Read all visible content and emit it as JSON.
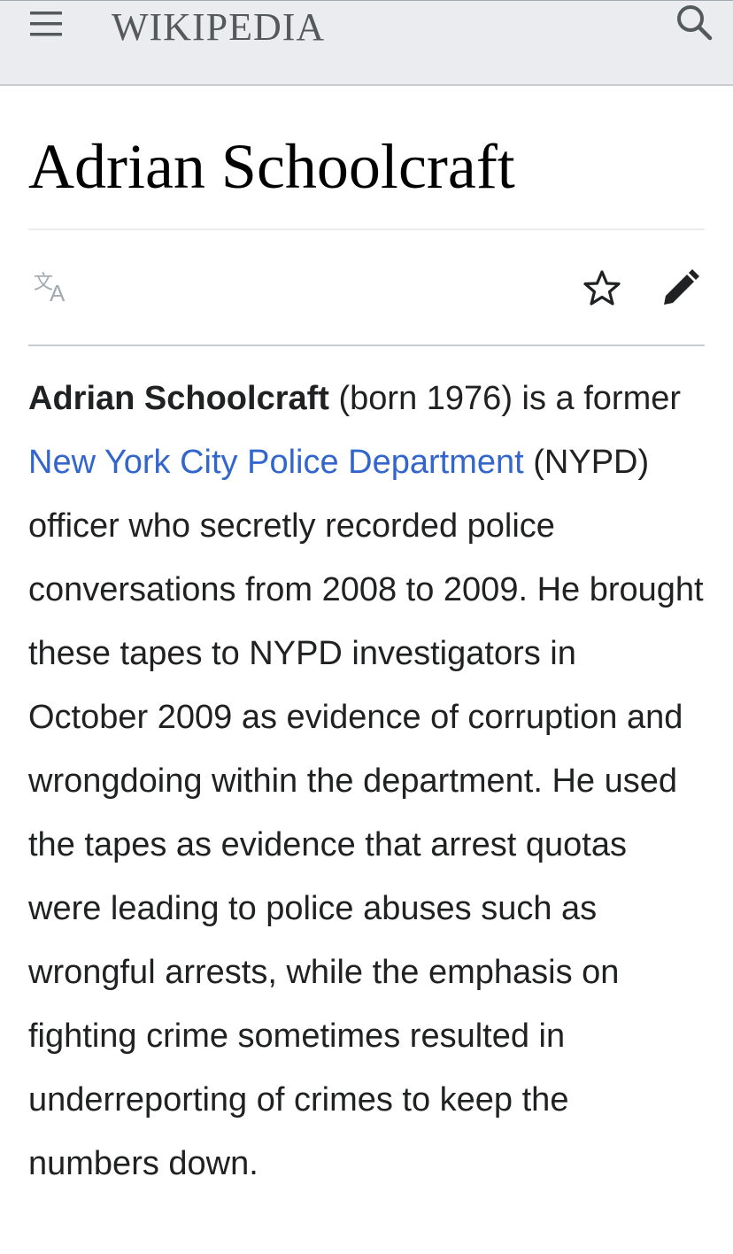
{
  "header": {
    "logo_text": "WIKIPEDIA",
    "menu_icon": "hamburger-menu-icon",
    "search_icon": "search-icon"
  },
  "article": {
    "title": "Adrian Schoolcraft",
    "actions": {
      "language_icon": "language-icon",
      "watch_icon": "star-icon",
      "edit_icon": "pencil-icon"
    },
    "lead": {
      "subject": "Adrian Schoolcraft",
      "text_1": " (born 1976) is a former ",
      "link_text": "New York City Police Department",
      "text_2": " (NYPD) officer who secretly recorded police conversations from 2008 to 2009. He brought these tapes to NYPD investigators in October 2009 as evidence of corruption and wrongdoing within the department. He used the tapes as evidence that arrest quotas were leading to police abuses such as wrongful arrests, while the emphasis on fighting crime sometimes resulted in underreporting of crimes to keep the numbers down."
    }
  },
  "colors": {
    "header_bg": "#eaecf0",
    "link": "#3366cc",
    "text": "#202122",
    "icon_gray": "#54595d",
    "icon_disabled": "#a2a9b1"
  }
}
